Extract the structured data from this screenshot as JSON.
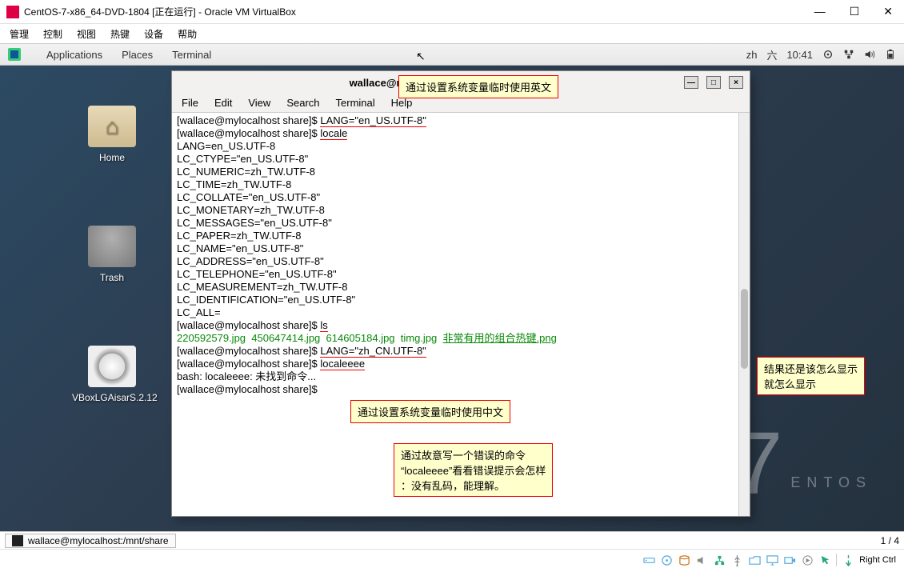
{
  "win": {
    "title": "CentOS-7-x86_64-DVD-1804 [正在运行] - Oracle VM VirtualBox",
    "min": "—",
    "max": "☐",
    "close": "✕"
  },
  "vboxMenu": [
    "管理",
    "控制",
    "视图",
    "热键",
    "设备",
    "帮助"
  ],
  "gnome": {
    "apps": "Applications",
    "places": "Places",
    "terminal": "Terminal",
    "lang": "zh",
    "day": "六",
    "time": "10:41"
  },
  "deskIcons": {
    "home": "Home",
    "trash": "Trash",
    "disc": "VBoxLGAisarS.2.12"
  },
  "centos": {
    "ver": "7",
    "name": "ENTOS"
  },
  "term": {
    "title": "wallace@mylocalhost:/mnt/share",
    "menus": [
      "File",
      "Edit",
      "View",
      "Search",
      "Terminal",
      "Help"
    ],
    "minLbl": "—",
    "maxLbl": "□",
    "closeLbl": "×",
    "lines": {
      "p1": "[wallace@mylocalhost share]$ ",
      "lang_en": "LANG=\"en_US.UTF-8\"",
      "locale": "locale",
      "l1": "LANG=en_US.UTF-8",
      "l2": "LC_CTYPE=\"en_US.UTF-8\"",
      "l3": "LC_NUMERIC=zh_TW.UTF-8",
      "l4": "LC_TIME=zh_TW.UTF-8",
      "l5": "LC_COLLATE=\"en_US.UTF-8\"",
      "l6": "LC_MONETARY=zh_TW.UTF-8",
      "l7": "LC_MESSAGES=\"en_US.UTF-8\"",
      "l8": "LC_PAPER=zh_TW.UTF-8",
      "l9": "LC_NAME=\"en_US.UTF-8\"",
      "l10": "LC_ADDRESS=\"en_US.UTF-8\"",
      "l11": "LC_TELEPHONE=\"en_US.UTF-8\"",
      "l12": "LC_MEASUREMENT=zh_TW.UTF-8",
      "l13": "LC_IDENTIFICATION=\"en_US.UTF-8\"",
      "l14": "LC_ALL=",
      "ls": "ls",
      "f1": "220592579.jpg  450647414.jpg  614605184.jpg  timg.jpg  ",
      "f2": "非常有用的组合热键.png",
      "lang_cn": "LANG=\"zh_CN.UTF-8\"",
      "localeeee": "localeeee",
      "bash": "bash: localeeee: 未找到命令..."
    }
  },
  "annots": {
    "a1": "通过设置系统变量临时使用英文",
    "a2": "结果还是该怎么显示\n就怎么显示",
    "a3": "通过设置系统变量临时使用中文",
    "a4": "通过故意写一个错误的命令\n“localeeee”看看错误提示会怎样\n：没有乱码，能理解。"
  },
  "taskbar": {
    "task": "wallace@mylocalhost:/mnt/share",
    "ws": "1 / 4"
  },
  "vboxStatus": {
    "rightCtrl": "Right Ctrl"
  }
}
